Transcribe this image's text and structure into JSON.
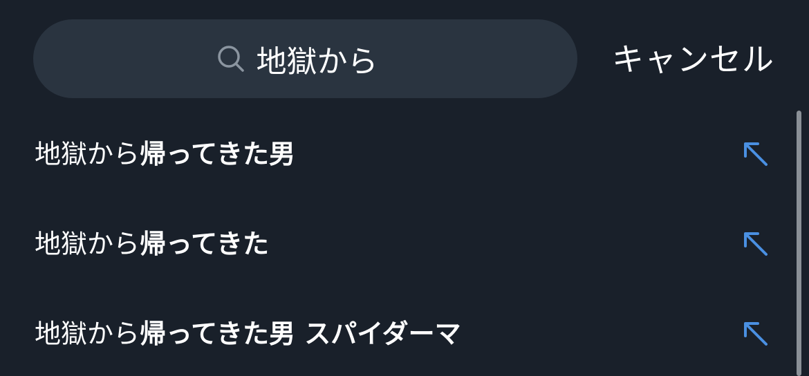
{
  "search": {
    "value": "地獄から",
    "icon": "search-icon"
  },
  "cancel_label": "キャンセル",
  "suggestions": [
    {
      "match": "地獄から",
      "rest": "帰ってきた男",
      "icon": "arrow-up-left-icon"
    },
    {
      "match": "地獄から",
      "rest": "帰ってきた",
      "icon": "arrow-up-left-icon"
    },
    {
      "match": "地獄から",
      "rest": "帰ってきた男 スパイダーマ",
      "icon": "arrow-up-left-icon"
    }
  ],
  "colors": {
    "background": "#19202a",
    "search_bg": "#2a3440",
    "accent": "#4a90e2",
    "icon_gray": "#8b95a0"
  }
}
